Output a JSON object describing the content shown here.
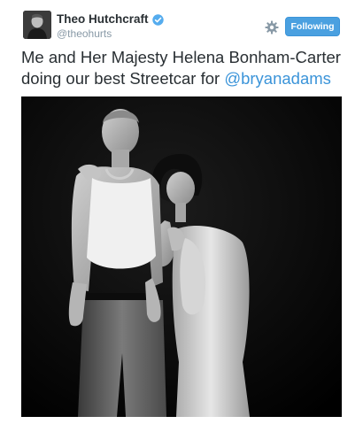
{
  "author": {
    "name": "Theo Hutchcraft",
    "handle": "@theohurts",
    "verified": true
  },
  "follow_button": {
    "label": "Following"
  },
  "tweet": {
    "text_before_mention": "Me and Her Majesty Helena Bonham-Carter doing our best Streetcar for ",
    "mention": "@bryanadams"
  },
  "icons": {
    "verified": "verified-badge-icon",
    "settings": "gear-icon"
  },
  "colors": {
    "accent": "#4aa0e0",
    "mention": "#3b94d9",
    "handle": "#8899a6",
    "text": "#292f33"
  }
}
